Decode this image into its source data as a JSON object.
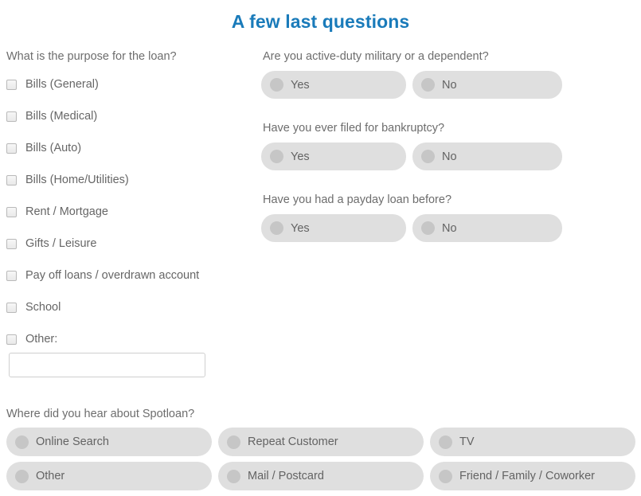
{
  "page": {
    "title": "A few last questions"
  },
  "purpose": {
    "question": "What is the purpose for the loan?",
    "options": [
      {
        "label": "Bills (General)"
      },
      {
        "label": "Bills (Medical)"
      },
      {
        "label": "Bills (Auto)"
      },
      {
        "label": "Bills (Home/Utilities)"
      },
      {
        "label": "Rent / Mortgage"
      },
      {
        "label": "Gifts / Leisure"
      },
      {
        "label": "Pay off loans / overdrawn account"
      },
      {
        "label": "School"
      },
      {
        "label": "Other:"
      }
    ],
    "other_input": {
      "value": "",
      "placeholder": ""
    }
  },
  "yesno_questions": [
    {
      "question": "Are you active-duty military or a dependent?",
      "yes_label": "Yes",
      "no_label": "No"
    },
    {
      "question": "Have you ever filed for bankruptcy?",
      "yes_label": "Yes",
      "no_label": "No"
    },
    {
      "question": "Have you had a payday loan before?",
      "yes_label": "Yes",
      "no_label": "No"
    }
  ],
  "hear_about": {
    "question": "Where did you hear about Spotloan?",
    "options": [
      {
        "label": "Online Search"
      },
      {
        "label": "Repeat Customer"
      },
      {
        "label": "TV"
      },
      {
        "label": "Other"
      },
      {
        "label": "Mail / Postcard"
      },
      {
        "label": "Friend / Family / Coworker"
      }
    ]
  },
  "colors": {
    "title_blue": "#1a7bba",
    "text_gray": "#666666",
    "pill_bg": "#dfdfdf",
    "radio_dot": "#c6c6c6",
    "checkbox_border": "#b9b9b9",
    "input_border": "#cfcfcf",
    "background": "#ffffff"
  }
}
